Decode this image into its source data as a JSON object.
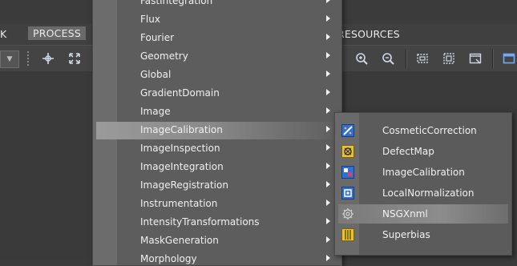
{
  "menubar": {
    "items": [
      {
        "label": "K"
      },
      {
        "label": "PROCESS"
      },
      {
        "label": "RESOURCES"
      }
    ]
  },
  "toolbar": {
    "icons": [
      "dropdown-arrow-icon",
      "crosshair-icon",
      "fit-view-icon",
      "zoom-in-icon",
      "zoom-out-icon",
      "select-rect-icon",
      "select-all-icon",
      "window-icon",
      "new-window-icon"
    ]
  },
  "process_menu": {
    "items": [
      {
        "label": "FastIntegration"
      },
      {
        "label": "Flux"
      },
      {
        "label": "Fourier"
      },
      {
        "label": "Geometry"
      },
      {
        "label": "Global"
      },
      {
        "label": "GradientDomain"
      },
      {
        "label": "Image"
      },
      {
        "label": "ImageCalibration"
      },
      {
        "label": "ImageInspection"
      },
      {
        "label": "ImageIntegration"
      },
      {
        "label": "ImageRegistration"
      },
      {
        "label": "Instrumentation"
      },
      {
        "label": "IntensityTransformations"
      },
      {
        "label": "MaskGeneration"
      },
      {
        "label": "Morphology"
      }
    ],
    "highlighted": "ImageCalibration"
  },
  "submenu": {
    "items": [
      {
        "label": "CosmeticCorrection",
        "icon": "cosmetic-correction-icon"
      },
      {
        "label": "DefectMap",
        "icon": "defect-map-icon"
      },
      {
        "label": "ImageCalibration",
        "icon": "image-calibration-icon"
      },
      {
        "label": "LocalNormalization",
        "icon": "local-normalization-icon"
      },
      {
        "label": "NSGXnml",
        "icon": "gear-icon"
      },
      {
        "label": "Superbias",
        "icon": "superbias-icon"
      }
    ],
    "highlighted": "NSGXnml"
  },
  "colors": {
    "menu_bg": "#5d5d5d",
    "highlight": "#9a9a9a",
    "icon_blue": "#2f6fd6",
    "icon_yellow": "#e8c230"
  }
}
